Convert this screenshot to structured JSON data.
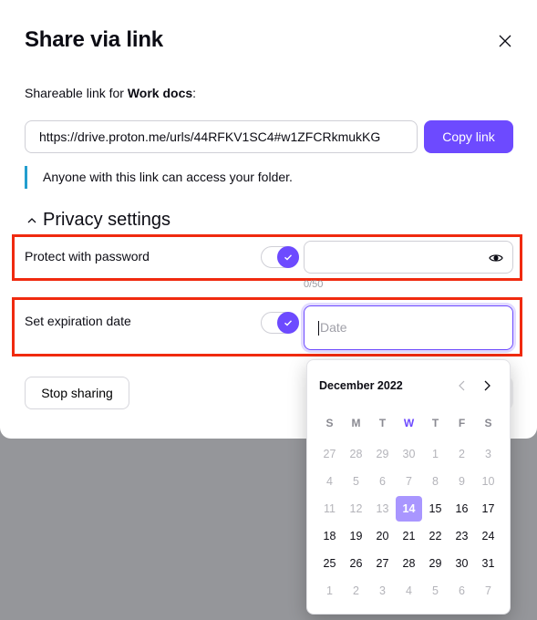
{
  "dialog": {
    "title": "Share via link",
    "shareable_prefix": "Shareable link for ",
    "folder_name": "Work docs",
    "shareable_suffix": ":",
    "url": "https://drive.proton.me/urls/44RFKV1SC4#w1ZFCRkmukKG",
    "copy_label": "Copy link",
    "notice": "Anyone with this link can access your folder.",
    "privacy_label": "Privacy settings",
    "password": {
      "label": "Protect with password",
      "enabled": true,
      "value": "",
      "counter": "0/50"
    },
    "expiration": {
      "label": "Set expiration date",
      "enabled": true,
      "placeholder": "Date"
    },
    "stop_sharing_label": "Stop sharing"
  },
  "calendar": {
    "month_label": "December 2022",
    "weekdays": [
      "S",
      "M",
      "T",
      "W",
      "T",
      "F",
      "S"
    ],
    "today_weekday_index": 3,
    "selected_day": 14,
    "weeks": [
      [
        {
          "d": "27",
          "m": true
        },
        {
          "d": "28",
          "m": true
        },
        {
          "d": "29",
          "m": true
        },
        {
          "d": "30",
          "m": true
        },
        {
          "d": "1",
          "m": true
        },
        {
          "d": "2",
          "m": true
        },
        {
          "d": "3",
          "m": true
        }
      ],
      [
        {
          "d": "4",
          "m": true
        },
        {
          "d": "5",
          "m": true
        },
        {
          "d": "6",
          "m": true
        },
        {
          "d": "7",
          "m": true
        },
        {
          "d": "8",
          "m": true
        },
        {
          "d": "9",
          "m": true
        },
        {
          "d": "10",
          "m": true
        }
      ],
      [
        {
          "d": "11",
          "m": true
        },
        {
          "d": "12",
          "m": true
        },
        {
          "d": "13",
          "m": true
        },
        {
          "d": "14",
          "s": true
        },
        {
          "d": "15"
        },
        {
          "d": "16"
        },
        {
          "d": "17"
        }
      ],
      [
        {
          "d": "18"
        },
        {
          "d": "19"
        },
        {
          "d": "20"
        },
        {
          "d": "21"
        },
        {
          "d": "22"
        },
        {
          "d": "23"
        },
        {
          "d": "24"
        }
      ],
      [
        {
          "d": "25"
        },
        {
          "d": "26"
        },
        {
          "d": "27"
        },
        {
          "d": "28"
        },
        {
          "d": "29"
        },
        {
          "d": "30"
        },
        {
          "d": "31"
        }
      ],
      [
        {
          "d": "1",
          "m": true
        },
        {
          "d": "2",
          "m": true
        },
        {
          "d": "3",
          "m": true
        },
        {
          "d": "4",
          "m": true
        },
        {
          "d": "5",
          "m": true
        },
        {
          "d": "6",
          "m": true
        },
        {
          "d": "7",
          "m": true
        }
      ]
    ]
  },
  "colors": {
    "accent": "#6d4aff",
    "selected_day": "#a996ff",
    "highlight_border": "#f02a0f",
    "notice_bar": "#239ece",
    "backdrop": "#95969a"
  }
}
